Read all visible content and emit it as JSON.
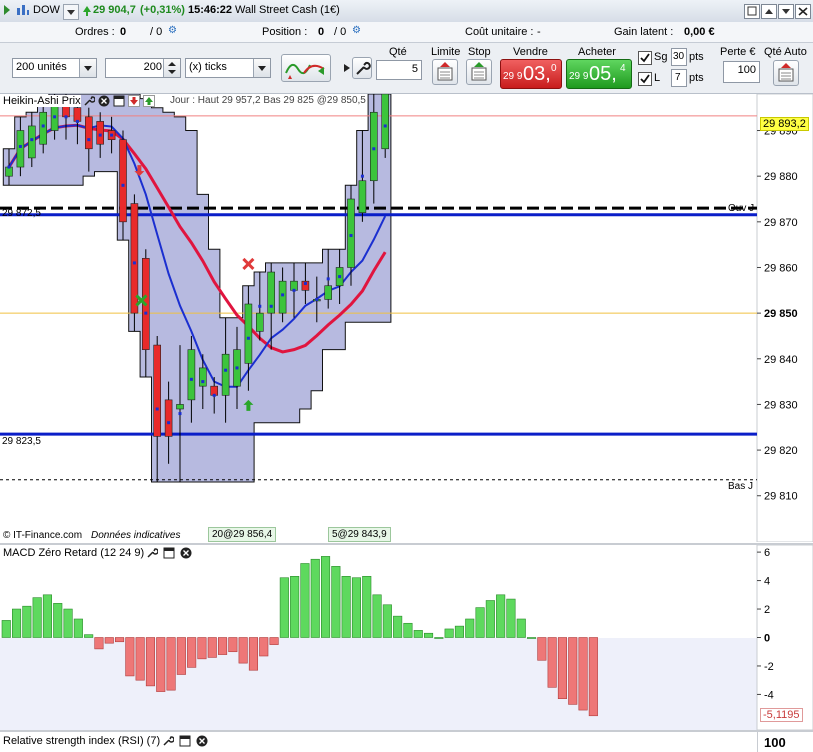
{
  "titlebar": {
    "symbol": "DOW",
    "price": "29 904,7",
    "change": "(+0,31%)",
    "time": "15:46:22",
    "instrument": "Wall Street Cash (1€)"
  },
  "infobar": {
    "orders_label": "Ordres :",
    "orders_value": "0",
    "orders_sep": "/ 0",
    "position_label": "Position :",
    "position_value": "0",
    "position_sep": "/ 0",
    "unit_cost_label": "Coût unitaire :",
    "unit_cost_value": "-",
    "latent_gain_label": "Gain latent :",
    "latent_gain_value": "0,00 €"
  },
  "toolbar": {
    "units_select": "200 unités",
    "ticks_value": "200",
    "ticks_select": "(x) ticks",
    "qty_label": "Qté",
    "qty_value": "5",
    "limit_label": "Limite",
    "stop_label": "Stop",
    "sell_label": "Vendre",
    "sell_price_small": "29 9",
    "sell_price_big": "03,",
    "sell_price_last": "0",
    "buy_label": "Acheter",
    "buy_price_small": "29 9",
    "buy_price_big": "05,",
    "buy_price_last": "4",
    "sg_label": "Sg",
    "sg_value": "30",
    "sg_unit": "pts",
    "l_label": "L",
    "l_value": "7",
    "l_unit": "pts",
    "loss_label": "Perte €",
    "loss_value": "100",
    "qty_auto_label": "Qté Auto"
  },
  "chart": {
    "panel_title": "Heikin-Ashi Prix",
    "overlay_text": "Jour : Haut 29 957,2 Bas 29 825 @29 850,5",
    "last_price_tag": "29 893,2",
    "ouv_label": "Ouv J",
    "bas_label": "Bas J",
    "left_level_upper": "29 872,5",
    "left_level_lower": "29 823,5",
    "copyright": "© IT-Finance.com",
    "data_note": "Données indicatives",
    "order_tag_1": "20@29 856,4",
    "order_tag_2": "5@29 843,9",
    "y_ticks": [
      "29 890",
      "29 880",
      "29 870",
      "29 860",
      "29 850",
      "29 840",
      "29 830",
      "29 820",
      "29 810"
    ],
    "colors": {
      "bull": "#3cc43c",
      "bear": "#e82a2a",
      "cloud": "#9fa3d6",
      "ma_fast": "#1b2fd0",
      "ma_slow": "#e0153f"
    }
  },
  "chart_data": {
    "type": "candlestick",
    "y_range": [
      29806,
      29898
    ],
    "candles": [
      {
        "o": 29880,
        "c": 29882,
        "h": 29886,
        "l": 29878
      },
      {
        "o": 29882,
        "c": 29890,
        "h": 29893,
        "l": 29880
      },
      {
        "o": 29884,
        "c": 29891,
        "h": 29894,
        "l": 29882
      },
      {
        "o": 29887,
        "c": 29894,
        "h": 29897,
        "l": 29885
      },
      {
        "o": 29890,
        "c": 29896,
        "h": 29898,
        "l": 29888
      },
      {
        "o": 29896,
        "c": 29893,
        "h": 29898,
        "l": 29888
      },
      {
        "o": 29895,
        "c": 29892,
        "h": 29897,
        "l": 29887
      },
      {
        "o": 29893,
        "c": 29886,
        "h": 29895,
        "l": 29881
      },
      {
        "o": 29892,
        "c": 29887,
        "h": 29894,
        "l": 29884
      },
      {
        "o": 29890,
        "c": 29888,
        "h": 29893,
        "l": 29885
      },
      {
        "o": 29888,
        "c": 29870,
        "h": 29890,
        "l": 29866
      },
      {
        "o": 29874,
        "c": 29850,
        "h": 29876,
        "l": 29846
      },
      {
        "o": 29862,
        "c": 29842,
        "h": 29864,
        "l": 29836
      },
      {
        "o": 29843,
        "c": 29823,
        "h": 29845,
        "l": 29813
      },
      {
        "o": 29831,
        "c": 29823,
        "h": 29835,
        "l": 29817
      },
      {
        "o": 29829,
        "c": 29830,
        "h": 29843,
        "l": 29813
      },
      {
        "o": 29831,
        "c": 29842,
        "h": 29845,
        "l": 29826
      },
      {
        "o": 29834,
        "c": 29838,
        "h": 29841,
        "l": 29829
      },
      {
        "o": 29834,
        "c": 29832,
        "h": 29836,
        "l": 29828
      },
      {
        "o": 29832,
        "c": 29841,
        "h": 29849,
        "l": 29826
      },
      {
        "o": 29834,
        "c": 29842,
        "h": 29847,
        "l": 29829
      },
      {
        "o": 29839,
        "c": 29852,
        "h": 29856,
        "l": 29833
      },
      {
        "o": 29846,
        "c": 29850,
        "h": 29859,
        "l": 29844
      },
      {
        "o": 29850,
        "c": 29859,
        "h": 29861,
        "l": 29842
      },
      {
        "o": 29850,
        "c": 29857,
        "h": 29860,
        "l": 29848
      },
      {
        "o": 29855,
        "c": 29857,
        "h": 29861,
        "l": 29849
      },
      {
        "o": 29857,
        "c": 29855,
        "h": 29861,
        "l": 29852
      },
      {
        "o": 29853,
        "c": 29853,
        "h": 29858,
        "l": 29848
      },
      {
        "o": 29853,
        "c": 29856,
        "h": 29864,
        "l": 29851
      },
      {
        "o": 29856,
        "c": 29860,
        "h": 29864,
        "l": 29852
      },
      {
        "o": 29860,
        "c": 29875,
        "h": 29878,
        "l": 29856
      },
      {
        "o": 29872,
        "c": 29879,
        "h": 29890,
        "l": 29870
      },
      {
        "o": 29879,
        "c": 29894,
        "h": 29898,
        "l": 29874
      },
      {
        "o": 29886,
        "c": 29898,
        "h": 29898,
        "l": 29884
      }
    ],
    "macd": {
      "title": "MACD Zéro Retard (12 24 9)",
      "y_range": [
        -6.5,
        6.5
      ],
      "ticks": [
        "6",
        "4",
        "2",
        "0",
        "-2",
        "-4"
      ],
      "last_value": "-5,1195",
      "bars": [
        1.2,
        2.0,
        2.2,
        2.8,
        3.0,
        2.4,
        2.0,
        1.3,
        0.2,
        -0.8,
        -0.4,
        -0.3,
        -2.7,
        -3.0,
        -3.4,
        -3.8,
        -3.7,
        -2.6,
        -2.1,
        -1.5,
        -1.4,
        -1.2,
        -1.0,
        -1.8,
        -2.3,
        -1.3,
        -0.5,
        4.2,
        4.3,
        5.2,
        5.5,
        5.7,
        5.0,
        4.3,
        4.2,
        4.3,
        3.0,
        2.3,
        1.5,
        1.0,
        0.5,
        0.3,
        0.0,
        0.6,
        0.8,
        1.3,
        2.1,
        2.6,
        3.0,
        2.7,
        1.3,
        0.0,
        -1.6,
        -3.5,
        -4.3,
        -4.7,
        -5.1,
        -5.5
      ]
    },
    "rsi": {
      "title": "Relative strength index (RSI) (7)",
      "tick": "100"
    }
  }
}
